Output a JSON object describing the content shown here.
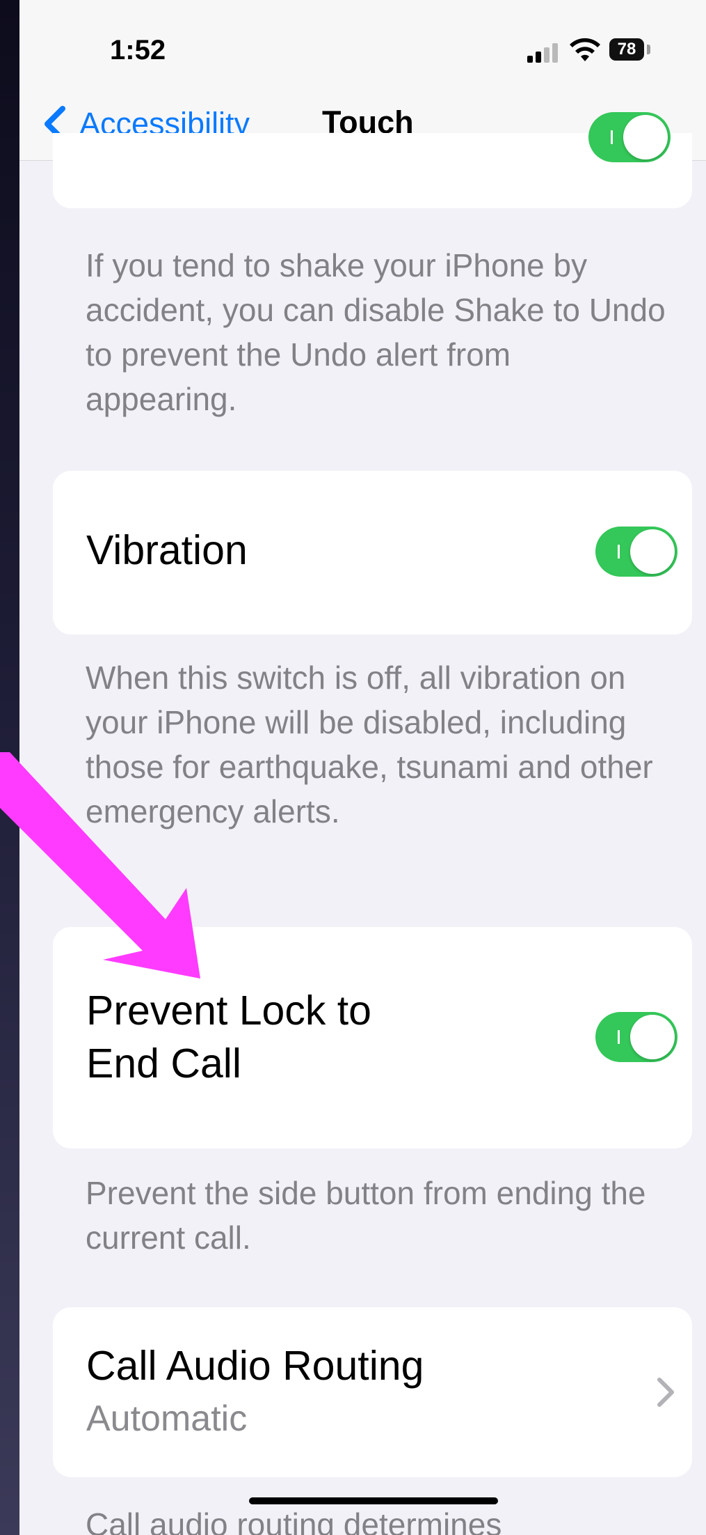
{
  "status_bar": {
    "time": "1:52",
    "battery_level": "78",
    "signal_bars_on": 2,
    "signal_bars_total": 4
  },
  "nav": {
    "back_label": "Accessibility",
    "title": "Touch"
  },
  "sections": {
    "shake_to_undo": {
      "toggle_on": true,
      "footnote": "If you tend to shake your iPhone by accident, you can disable Shake to Undo to prevent the Undo alert from appearing."
    },
    "vibration": {
      "title": "Vibration",
      "toggle_on": true,
      "footnote": "When this switch is off, all vibration on your iPhone will be disabled, including those for earthquake, tsunami and other emergency alerts."
    },
    "prevent_lock": {
      "title_line1": "Prevent Lock to",
      "title_line2": "End Call",
      "toggle_on": true,
      "footnote": "Prevent the side button from ending the current call."
    },
    "call_audio_routing": {
      "title": "Call Audio Routing",
      "value": "Automatic",
      "footnote": "Call audio routing determines"
    }
  },
  "colors": {
    "accent": "#0a7aff",
    "toggle_on": "#34c759",
    "annotation_arrow": "#ff3bff"
  },
  "icons": [
    "back-chevron-icon",
    "signal-icon",
    "wifi-icon",
    "battery-icon",
    "chevron-right-icon",
    "pointer-arrow"
  ]
}
